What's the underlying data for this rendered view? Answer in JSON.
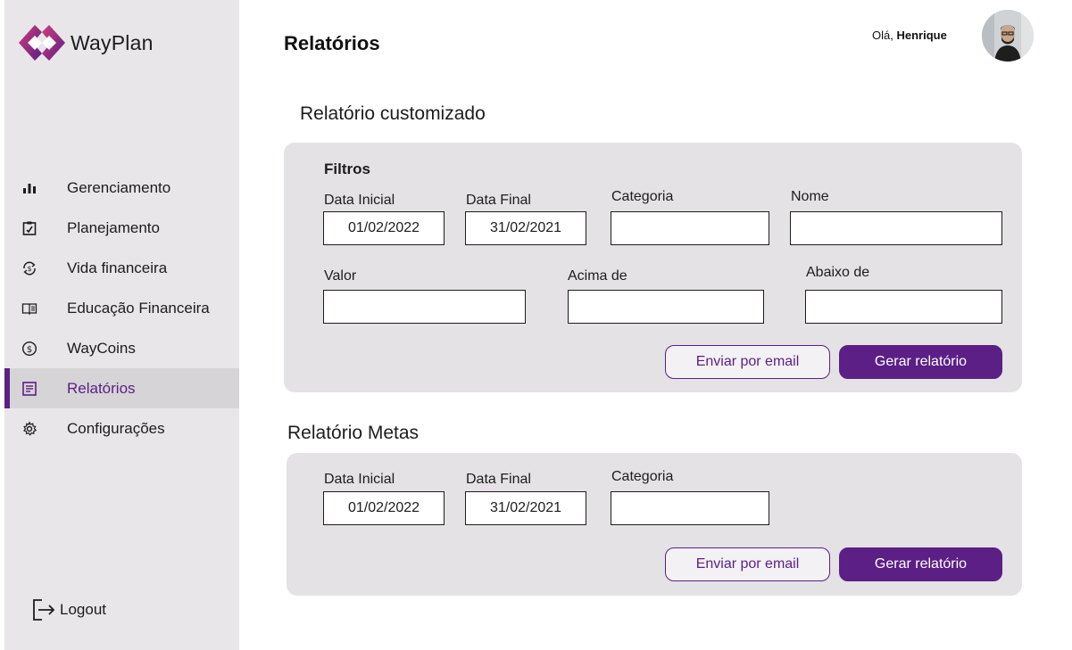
{
  "app": {
    "name": "WayPlan",
    "brand_color": "#5b1f86",
    "accent_color": "#b0357a"
  },
  "header": {
    "title": "Relatórios",
    "greeting_prefix": "Olá,",
    "user_name": "Henrique"
  },
  "sidebar": {
    "items": [
      {
        "label": "Gerenciamento",
        "icon": "bar-chart-icon",
        "active": false
      },
      {
        "label": "Planejamento",
        "icon": "clipboard-check-icon",
        "active": false
      },
      {
        "label": "Vida financeira",
        "icon": "money-cycle-icon",
        "active": false
      },
      {
        "label": "Educação Financeira",
        "icon": "book-icon",
        "active": false
      },
      {
        "label": "WayCoins",
        "icon": "coin-icon",
        "active": false
      },
      {
        "label": "Relatórios",
        "icon": "report-icon",
        "active": true
      },
      {
        "label": "Configurações",
        "icon": "gear-icon",
        "active": false
      }
    ],
    "logout_label": "Logout"
  },
  "custom_report": {
    "title": "Relatório customizado",
    "filters_heading": "Filtros",
    "start_date_label": "Data Inicial",
    "start_date_value": "01/02/2022",
    "end_date_label": "Data Final",
    "end_date_value": "31/02/2021",
    "category_label": "Categoria",
    "category_value": "",
    "name_label": "Nome",
    "name_value": "",
    "value_label": "Valor",
    "value_value": "",
    "above_label": "Acima de",
    "above_value": "",
    "below_label": "Abaixo de",
    "below_value": "",
    "email_button": "Enviar por email",
    "generate_button": "Gerar relatório"
  },
  "goals_report": {
    "title": "Relatório Metas",
    "start_date_label": "Data Inicial",
    "start_date_value": "01/02/2022",
    "end_date_label": "Data Final",
    "end_date_value": "31/02/2021",
    "category_label": "Categoria",
    "category_value": "",
    "email_button": "Enviar por email",
    "generate_button": "Gerar relatório"
  }
}
